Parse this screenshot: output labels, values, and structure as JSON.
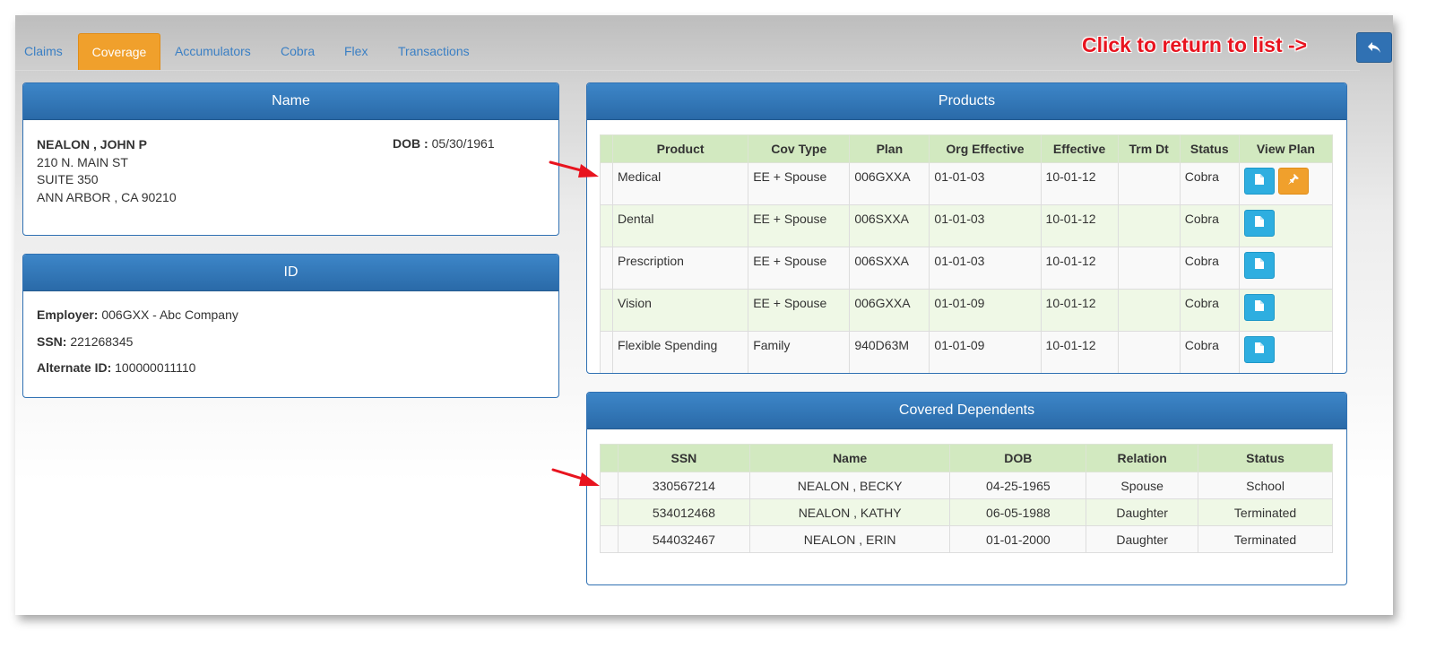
{
  "tabs": [
    {
      "label": "Claims"
    },
    {
      "label": "Coverage"
    },
    {
      "label": "Accumulators"
    },
    {
      "label": "Cobra"
    },
    {
      "label": "Flex"
    },
    {
      "label": "Transactions"
    }
  ],
  "active_tab": "Coverage",
  "return_hint": "Click to return to list ->",
  "return_icon": "reply-icon",
  "name_panel": {
    "title": "Name",
    "name": "NEALON , JOHN P",
    "address1": "210 N. MAIN ST",
    "address2": "SUITE 350",
    "city_line": "ANN ARBOR , CA 90210",
    "dob_label": "DOB :",
    "dob": "05/30/1961"
  },
  "id_panel": {
    "title": "ID",
    "employer_label": "Employer:",
    "employer": "006GXX - Abc Company",
    "ssn_label": "SSN:",
    "ssn": "221268345",
    "alt_label": "Alternate ID:",
    "alt_id": "100000011110"
  },
  "products_panel": {
    "title": "Products",
    "headers": [
      "Product",
      "Cov Type",
      "Plan",
      "Org Effective",
      "Effective",
      "Trm Dt",
      "Status",
      "View Plan"
    ],
    "rows": [
      {
        "product": "Medical",
        "cov_type": "EE + Spouse",
        "plan": "006GXXA",
        "org_effective": "01-01-03",
        "effective": "10-01-12",
        "trm_dt": "",
        "status": "Cobra"
      },
      {
        "product": "Dental",
        "cov_type": "EE + Spouse",
        "plan": "006SXXA",
        "org_effective": "01-01-03",
        "effective": "10-01-12",
        "trm_dt": "",
        "status": "Cobra"
      },
      {
        "product": "Prescription",
        "cov_type": "EE + Spouse",
        "plan": "006SXXA",
        "org_effective": "01-01-03",
        "effective": "10-01-12",
        "trm_dt": "",
        "status": "Cobra"
      },
      {
        "product": "Vision",
        "cov_type": "EE + Spouse",
        "plan": "006GXXA",
        "org_effective": "01-01-09",
        "effective": "10-01-12",
        "trm_dt": "",
        "status": "Cobra"
      },
      {
        "product": "Flexible Spending",
        "cov_type": "Family",
        "plan": "940D63M",
        "org_effective": "01-01-09",
        "effective": "10-01-12",
        "trm_dt": "",
        "status": "Cobra"
      }
    ]
  },
  "dependents_panel": {
    "title": "Covered Dependents",
    "headers": [
      "SSN",
      "Name",
      "DOB",
      "Relation",
      "Status"
    ],
    "rows": [
      {
        "ssn": "330567214",
        "name": "NEALON , BECKY",
        "dob": "04-25-1965",
        "relation": "Spouse",
        "status": "School"
      },
      {
        "ssn": "534012468",
        "name": "NEALON , KATHY",
        "dob": "06-05-1988",
        "relation": "Daughter",
        "status": "Terminated"
      },
      {
        "ssn": "544032467",
        "name": "NEALON , ERIN",
        "dob": "01-01-2000",
        "relation": "Daughter",
        "status": "Terminated"
      }
    ]
  },
  "colors": {
    "accent": "#3071b3",
    "active_tab": "#f0a02c",
    "header_green": "#d2e9c0",
    "annotation_red": "#e8141f"
  }
}
